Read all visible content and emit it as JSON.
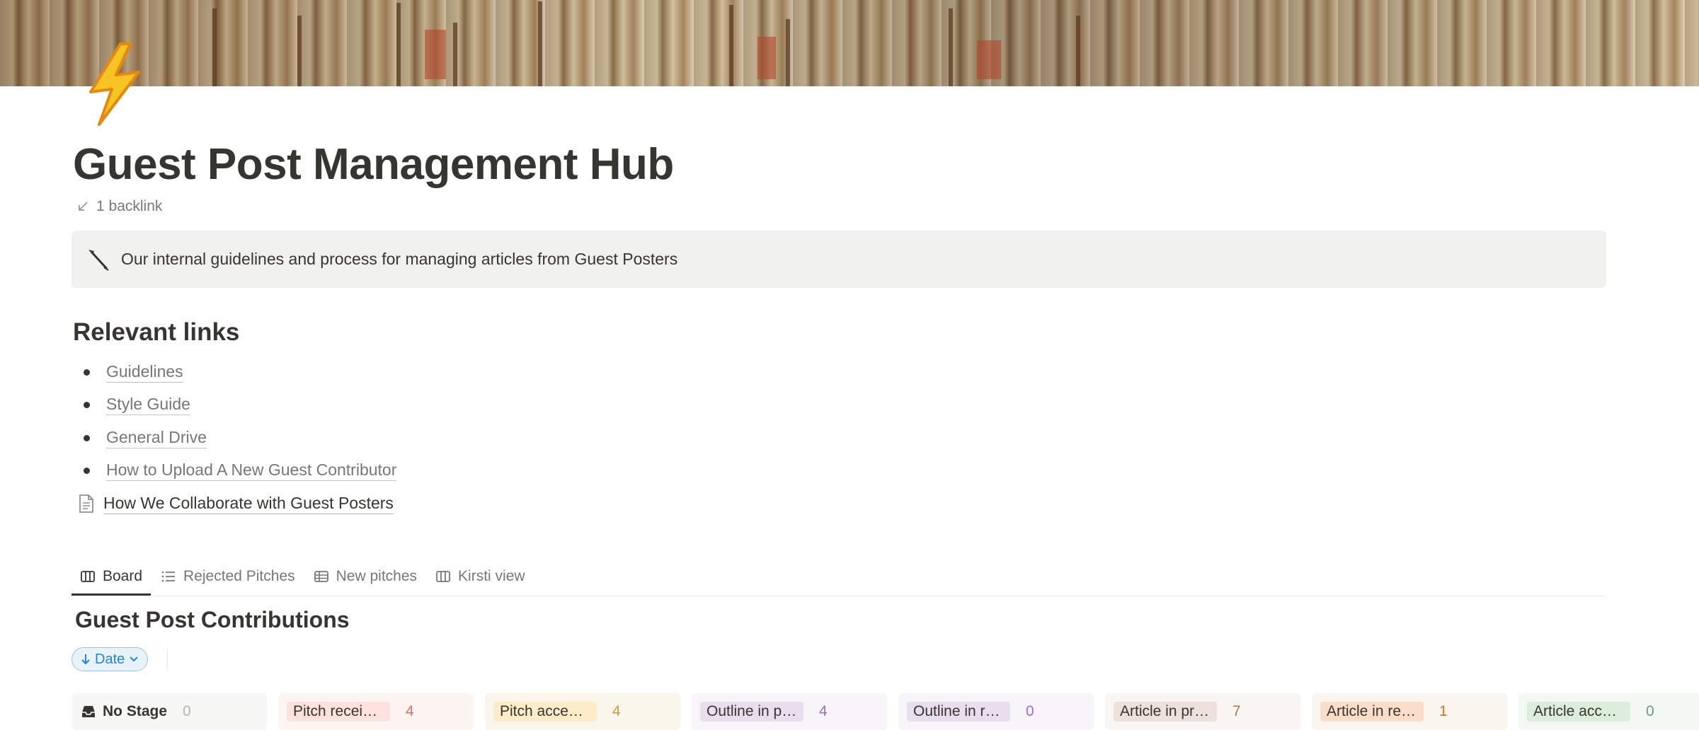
{
  "page": {
    "title": "Guest Post Management Hub",
    "backlinks": "1 backlink"
  },
  "callout": {
    "text": "Our internal guidelines and process for managing articles from Guest Posters"
  },
  "links_section": {
    "heading": "Relevant links",
    "items": [
      {
        "label": "Guidelines",
        "type": "bullet"
      },
      {
        "label": "Style Guide",
        "type": "bullet"
      },
      {
        "label": "General Drive",
        "type": "bullet"
      },
      {
        "label": "How to Upload A New Guest Contributor",
        "type": "bullet"
      },
      {
        "label": "How We Collaborate with Guest Posters",
        "type": "page",
        "icon": "page-icon"
      }
    ]
  },
  "views": {
    "tabs": [
      {
        "label": "Board",
        "icon": "board-icon",
        "active": true
      },
      {
        "label": "Rejected Pitches",
        "icon": "list-icon",
        "active": false
      },
      {
        "label": "New pitches",
        "icon": "table-icon",
        "active": false
      },
      {
        "label": "Kirsti view",
        "icon": "board-icon",
        "active": false
      }
    ]
  },
  "database": {
    "title": "Guest Post Contributions",
    "sort_label": "Date"
  },
  "board": {
    "columns": [
      {
        "label": "No Stage",
        "count": "0",
        "chip_bg": "",
        "col_bg": "#f7f7f5",
        "count_color": "#b4b4b0"
      },
      {
        "label": "Pitch received",
        "count": "4",
        "chip_bg": "#ffe2dd",
        "col_bg": "#fdf5f2",
        "count_color": "#e16f64"
      },
      {
        "label": "Pitch accepted",
        "count": "4",
        "chip_bg": "#fdecc8",
        "col_bg": "#fbf6ec",
        "count_color": "#d09c34"
      },
      {
        "label": "Outline in progress",
        "count": "4",
        "chip_bg": "#e8deee",
        "col_bg": "#f8f5fa",
        "count_color": "#9a6dd7"
      },
      {
        "label": "Outline in review",
        "count": "0",
        "chip_bg": "#e8deee",
        "col_bg": "#f8f5fa",
        "count_color": "#9a6dd7"
      },
      {
        "label": "Article in progress",
        "count": "7",
        "chip_bg": "#eee0da",
        "col_bg": "#f9f5f3",
        "count_color": "#ad7a63"
      },
      {
        "label": "Article in review",
        "count": "1",
        "chip_bg": "#fadec9",
        "col_bg": "#fbf5f0",
        "count_color": "#d9730d"
      },
      {
        "label": "Article accepted",
        "count": "0",
        "chip_bg": "#dbeddb",
        "col_bg": "#f4f8f3",
        "count_color": "#6c9b7d"
      }
    ]
  },
  "icons": {
    "page_icon": "lightning-bolt-icon",
    "callout_icon": "feather-pen-icon",
    "backlink_icon": "arrow-down-left-icon",
    "sort_icon": "arrow-down-icon",
    "no_stage_icon": "inbox-tray-icon"
  }
}
